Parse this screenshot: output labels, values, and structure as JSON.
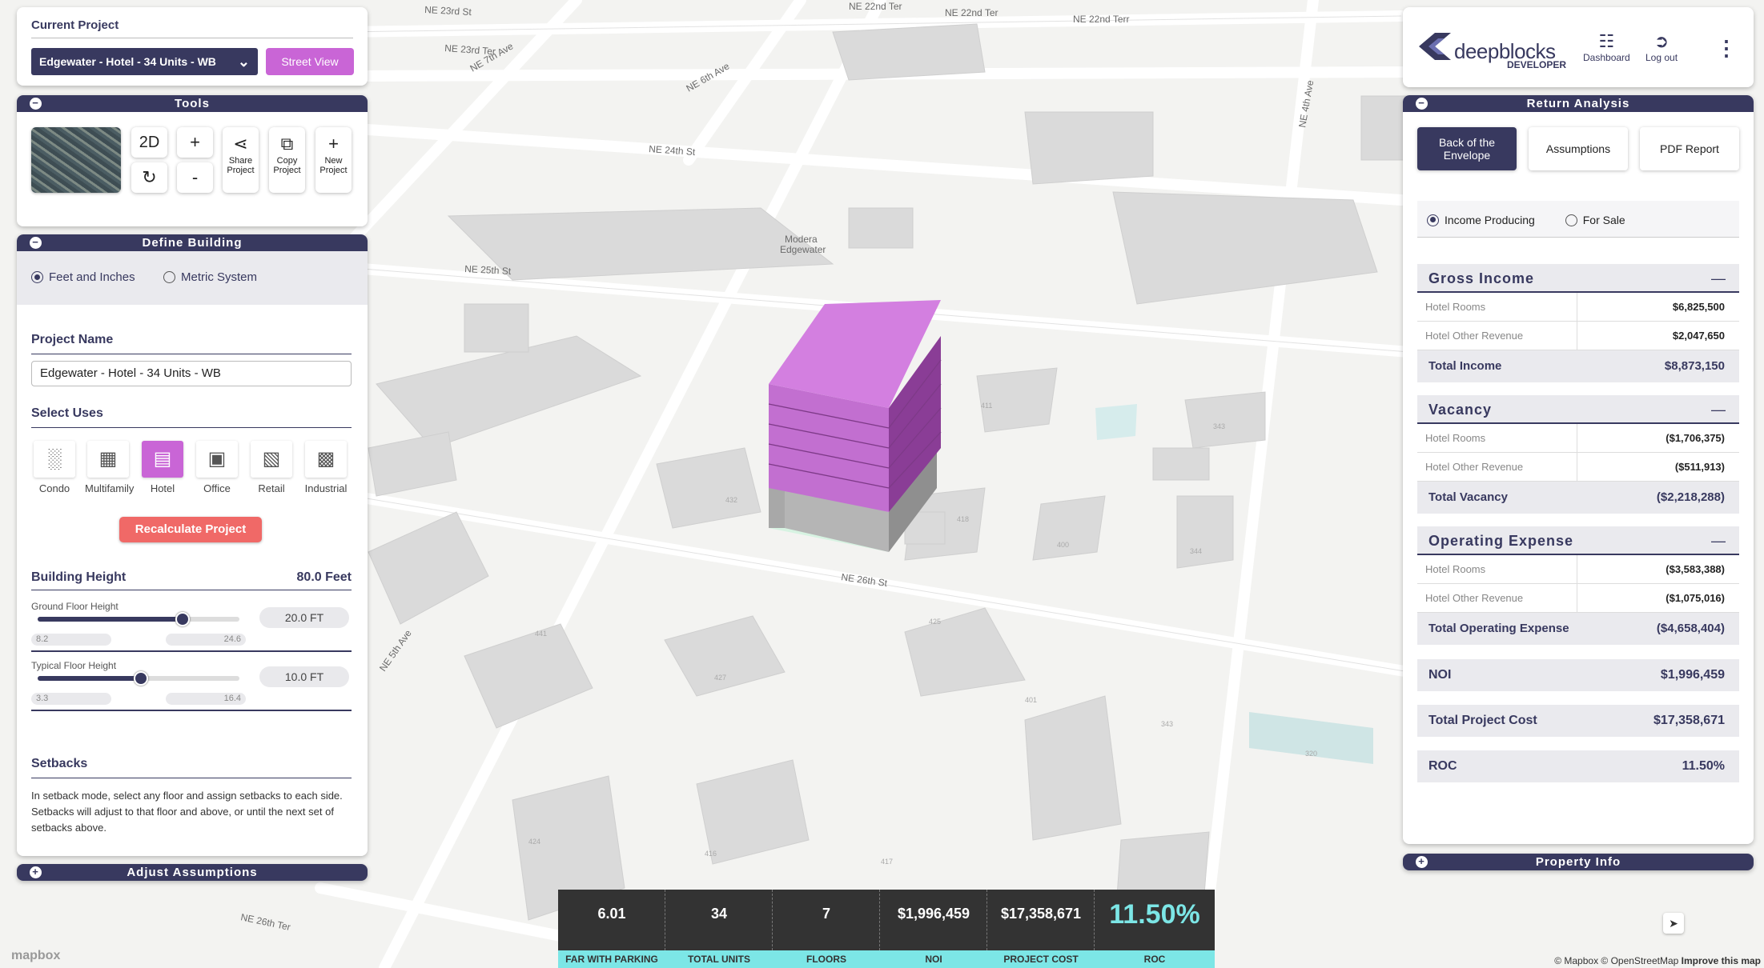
{
  "current_project": {
    "title": "Current Project",
    "selected": "Edgewater - Hotel - 34 Units - WB",
    "street_view": "Street View"
  },
  "tools": {
    "title": "Tools",
    "btn_2d": "2D",
    "plus": "+",
    "minus": "-",
    "share": "Share Project",
    "copy": "Copy Project",
    "new": "New Project"
  },
  "define_building": {
    "title": "Define Building",
    "unit_options": [
      "Feet and Inches",
      "Metric System"
    ],
    "selected_unit": "Feet and Inches",
    "project_name_label": "Project Name",
    "project_name": "Edgewater - Hotel - 34 Units - WB",
    "select_uses_label": "Select Uses",
    "uses": [
      {
        "label": "Condo",
        "icon": "condo-icon"
      },
      {
        "label": "Multifamily",
        "icon": "multifamily-icon"
      },
      {
        "label": "Hotel",
        "icon": "hotel-icon",
        "selected": true
      },
      {
        "label": "Office",
        "icon": "office-icon"
      },
      {
        "label": "Retail",
        "icon": "retail-icon"
      },
      {
        "label": "Industrial",
        "icon": "industrial-icon"
      }
    ],
    "recalculate": "Recalculate Project",
    "building_height_label": "Building Height",
    "building_height": "80.0 Feet",
    "ground_floor": {
      "label": "Ground Floor Height",
      "value": "20.0 FT",
      "min": "8.2",
      "max": "24.6",
      "level": 0.72
    },
    "typical_floor": {
      "label": "Typical Floor Height",
      "value": "10.0 FT",
      "min": "3.3",
      "max": "16.4",
      "level": 0.51
    },
    "setbacks_label": "Setbacks",
    "setbacks_text": "In setback mode, select any floor and assign setbacks to each side. Setbacks will adjust to that floor and above, or until the next set of setbacks above."
  },
  "adjust_assumptions": "Adjust Assumptions",
  "brand": {
    "name": "deepblocks",
    "sub": "DEVELOPER",
    "dashboard": "Dashboard",
    "logout": "Log out"
  },
  "return_analysis": {
    "title": "Return Analysis",
    "tabs": [
      "Back of the Envelope",
      "Assumptions",
      "PDF Report"
    ],
    "property_types": [
      "Income Producing",
      "For Sale"
    ],
    "gross_income": {
      "title": "Gross Income",
      "rows": [
        {
          "label": "Hotel Rooms",
          "value": "$6,825,500"
        },
        {
          "label": "Hotel Other Revenue",
          "value": "$2,047,650"
        }
      ],
      "total_label": "Total Income",
      "total": "$8,873,150"
    },
    "vacancy": {
      "title": "Vacancy",
      "rows": [
        {
          "label": "Hotel Rooms",
          "value": "($1,706,375)"
        },
        {
          "label": "Hotel Other Revenue",
          "value": "($511,913)"
        }
      ],
      "total_label": "Total Vacancy",
      "total": "($2,218,288)"
    },
    "operating_expense": {
      "title": "Operating Expense",
      "rows": [
        {
          "label": "Hotel Rooms",
          "value": "($3,583,388)"
        },
        {
          "label": "Hotel Other Revenue",
          "value": "($1,075,016)"
        }
      ],
      "total_label": "Total Operating Expense",
      "total": "($4,658,404)"
    },
    "noi_label": "NOI",
    "noi": "$1,996,459",
    "tpc_label": "Total Project Cost",
    "tpc": "$17,358,671",
    "roc_label": "ROC",
    "roc": "11.50%"
  },
  "property_info": "Property Info",
  "stats": [
    {
      "value": "6.01",
      "label": "FAR WITH PARKING"
    },
    {
      "value": "34",
      "label": "TOTAL UNITS"
    },
    {
      "value": "7",
      "label": "FLOORS"
    },
    {
      "value": "$1,996,459",
      "label": "NOI"
    },
    {
      "value": "$17,358,671",
      "label": "PROJECT COST"
    },
    {
      "value": "11.50%",
      "label": "ROC"
    }
  ],
  "map": {
    "streets": [
      "NE 23rd St",
      "NE 22nd Ter",
      "NE 22nd Ter",
      "NE 22nd Terr",
      "NE 23rd Ter",
      "NE 7th Ave",
      "NE 6th Ave",
      "NE 24th St",
      "NE 25th St",
      "NE 26th St",
      "NE 26th Ter",
      "NE 5th Ave",
      "NE 4th Ave",
      "NE 7th Ave"
    ],
    "poi": [
      "Modera",
      "Edgewater"
    ],
    "attribution": "© Mapbox © OpenStreetMap",
    "improve": "Improve this map",
    "logo": "mapbox"
  }
}
